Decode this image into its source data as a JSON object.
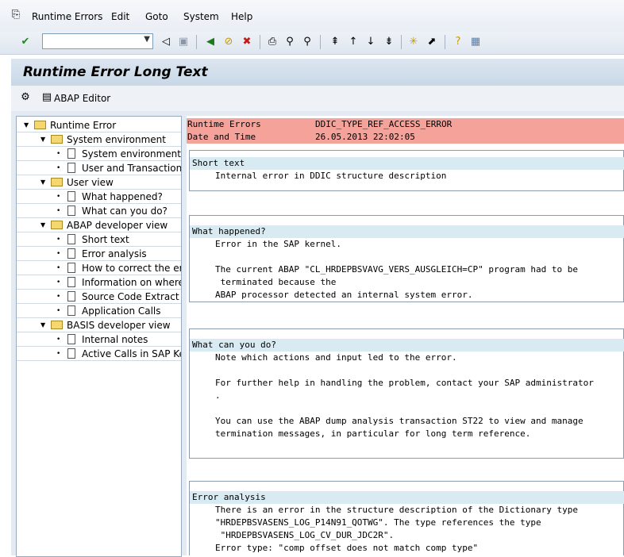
{
  "menu": {
    "runtime_errors": "Runtime Errors",
    "edit": "Edit",
    "goto": "Goto",
    "system": "System",
    "help": "Help"
  },
  "page_title": "Runtime Error Long Text",
  "app_toolbar": {
    "abap_editor": "ABAP Editor"
  },
  "tree": {
    "root": "Runtime Error",
    "system_environment_group": "System environment",
    "system_environment": "System environment",
    "user_and_transaction": "User and Transaction",
    "user_view": "User view",
    "what_happened": "What happened?",
    "what_can_you_do": "What can you do?",
    "abap_developer_view": "ABAP developer view",
    "short_text": "Short text",
    "error_analysis": "Error analysis",
    "how_to_correct": "How to correct the er",
    "information_on_where": "Information on where",
    "source_code_extract": "Source Code Extract",
    "application_calls": "Application Calls",
    "basis_developer_view": "BASIS developer view",
    "internal_notes": "Internal notes",
    "active_calls": "Active Calls in SAP Ker"
  },
  "header": {
    "runtime_errors_label": "Runtime Errors",
    "runtime_errors_value": "DDIC_TYPE_REF_ACCESS_ERROR",
    "date_time_label": "Date and Time",
    "date_time_value": "26.05.2013 22:02:05"
  },
  "short_text": {
    "title": "Short text",
    "line1": "Internal error in DDIC structure description"
  },
  "what_happened": {
    "title": "What happened?",
    "line1": "Error in the SAP kernel.",
    "line2": "The current ABAP \"CL_HRDEPBSVAVG_VERS_AUSGLEICH=CP\" program had to be",
    "line3": " terminated because the",
    "line4": "ABAP processor detected an internal system error."
  },
  "what_can_you_do": {
    "title": "What can you do?",
    "line1": "Note which actions and input led to the error.",
    "line2": "For further help in handling the problem, contact your SAP administrator",
    "line3": ".",
    "line4": "You can use the ABAP dump analysis transaction ST22 to view and manage",
    "line5": "termination messages, in particular for long term reference."
  },
  "error_analysis": {
    "title": "Error analysis",
    "line1": "There is an error in the structure description of the Dictionary type",
    "line2": "\"HRDEPBSVASENS_LOG_P14N91_QOTWG\". The type references the type",
    "line3": " \"HRDEPBSVASENS_LOG_CV_DUR_JDC2R\".",
    "line4": "Error type: \"comp offset does not match comp type\""
  },
  "colors": {
    "header_row": "#f4a29a",
    "section_title": "#d8ebf2",
    "background": "#e4eaf1"
  }
}
